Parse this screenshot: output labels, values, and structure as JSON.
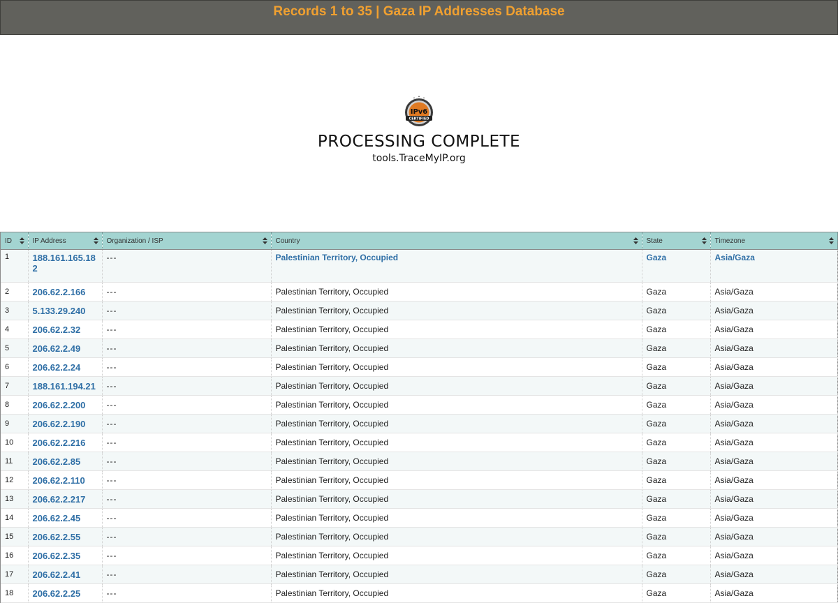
{
  "header": {
    "title": "Records 1 to 35 | Gaza IP Addresses Database"
  },
  "status": {
    "badge_text": "IPv6",
    "badge_sub": "CERTIFIED",
    "title": "PROCESSING COMPLETE",
    "subtitle": "tools.TraceMyIP.org"
  },
  "table": {
    "columns": [
      "ID",
      "IP Address",
      "Organization / ISP",
      "Country",
      "State",
      "Timezone"
    ],
    "rows": [
      {
        "id": "1",
        "ip": "188.161.165.182",
        "org": "---",
        "country": "Palestinian Territory, Occupied",
        "state": "Gaza",
        "tz": "Asia/Gaza"
      },
      {
        "id": "2",
        "ip": "206.62.2.166",
        "org": "---",
        "country": "Palestinian Territory, Occupied",
        "state": "Gaza",
        "tz": "Asia/Gaza"
      },
      {
        "id": "3",
        "ip": "5.133.29.240",
        "org": "---",
        "country": "Palestinian Territory, Occupied",
        "state": "Gaza",
        "tz": "Asia/Gaza"
      },
      {
        "id": "4",
        "ip": "206.62.2.32",
        "org": "---",
        "country": "Palestinian Territory, Occupied",
        "state": "Gaza",
        "tz": "Asia/Gaza"
      },
      {
        "id": "5",
        "ip": "206.62.2.49",
        "org": "---",
        "country": "Palestinian Territory, Occupied",
        "state": "Gaza",
        "tz": "Asia/Gaza"
      },
      {
        "id": "6",
        "ip": "206.62.2.24",
        "org": "---",
        "country": "Palestinian Territory, Occupied",
        "state": "Gaza",
        "tz": "Asia/Gaza"
      },
      {
        "id": "7",
        "ip": "188.161.194.21",
        "org": "---",
        "country": "Palestinian Territory, Occupied",
        "state": "Gaza",
        "tz": "Asia/Gaza"
      },
      {
        "id": "8",
        "ip": "206.62.2.200",
        "org": "---",
        "country": "Palestinian Territory, Occupied",
        "state": "Gaza",
        "tz": "Asia/Gaza"
      },
      {
        "id": "9",
        "ip": "206.62.2.190",
        "org": "---",
        "country": "Palestinian Territory, Occupied",
        "state": "Gaza",
        "tz": "Asia/Gaza"
      },
      {
        "id": "10",
        "ip": "206.62.2.216",
        "org": "---",
        "country": "Palestinian Territory, Occupied",
        "state": "Gaza",
        "tz": "Asia/Gaza"
      },
      {
        "id": "11",
        "ip": "206.62.2.85",
        "org": "---",
        "country": "Palestinian Territory, Occupied",
        "state": "Gaza",
        "tz": "Asia/Gaza"
      },
      {
        "id": "12",
        "ip": "206.62.2.110",
        "org": "---",
        "country": "Palestinian Territory, Occupied",
        "state": "Gaza",
        "tz": "Asia/Gaza"
      },
      {
        "id": "13",
        "ip": "206.62.2.217",
        "org": "---",
        "country": "Palestinian Territory, Occupied",
        "state": "Gaza",
        "tz": "Asia/Gaza"
      },
      {
        "id": "14",
        "ip": "206.62.2.45",
        "org": "---",
        "country": "Palestinian Territory, Occupied",
        "state": "Gaza",
        "tz": "Asia/Gaza"
      },
      {
        "id": "15",
        "ip": "206.62.2.55",
        "org": "---",
        "country": "Palestinian Territory, Occupied",
        "state": "Gaza",
        "tz": "Asia/Gaza"
      },
      {
        "id": "16",
        "ip": "206.62.2.35",
        "org": "---",
        "country": "Palestinian Territory, Occupied",
        "state": "Gaza",
        "tz": "Asia/Gaza"
      },
      {
        "id": "17",
        "ip": "206.62.2.41",
        "org": "---",
        "country": "Palestinian Territory, Occupied",
        "state": "Gaza",
        "tz": "Asia/Gaza"
      },
      {
        "id": "18",
        "ip": "206.62.2.25",
        "org": "---",
        "country": "Palestinian Territory, Occupied",
        "state": "Gaza",
        "tz": "Asia/Gaza"
      }
    ]
  },
  "colors": {
    "header_bg": "#61615c",
    "header_text": "#f0a030",
    "table_header_bg": "#a3d4d1",
    "link": "#2f6fa6"
  },
  "icons": {
    "badge": "ipv6-certified-badge-icon",
    "sort": "sort-arrows-icon"
  }
}
